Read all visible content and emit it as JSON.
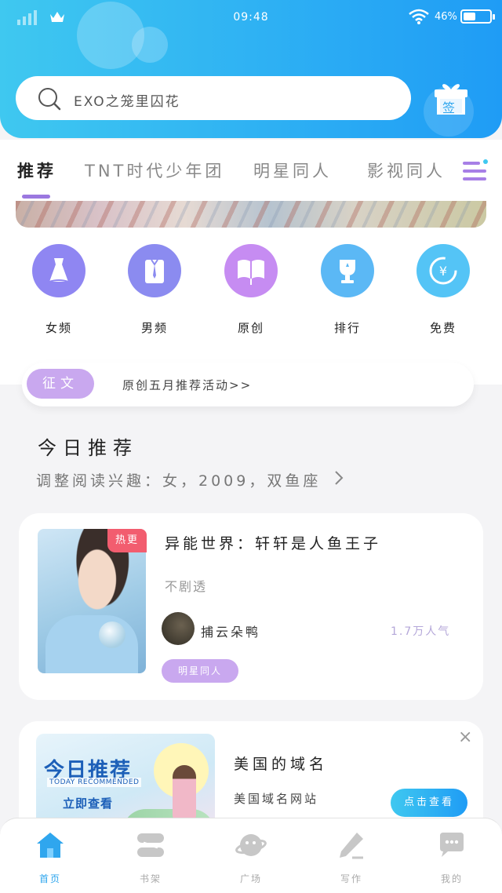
{
  "status_bar": {
    "time": "09:48",
    "battery_percent": "46%",
    "battery_level": 0.46
  },
  "search": {
    "placeholder": "EXO之笼里囚花"
  },
  "gift_badge": "签",
  "tabs": [
    {
      "label": "推荐",
      "active": true
    },
    {
      "label": "TNT时代少年团",
      "active": false
    },
    {
      "label": "明星同人",
      "active": false
    },
    {
      "label": "影视同人",
      "active": false
    }
  ],
  "categories": [
    {
      "label": "女频",
      "icon": "dress-icon",
      "color": "#8f86f2"
    },
    {
      "label": "男频",
      "icon": "shirt-icon",
      "color": "#8b8bf0"
    },
    {
      "label": "原创",
      "icon": "book-icon",
      "color": "#c68cf2"
    },
    {
      "label": "排行",
      "icon": "trophy-icon",
      "color": "#5bb8f5"
    },
    {
      "label": "免费",
      "icon": "yen-icon",
      "color": "#54c4f6"
    }
  ],
  "notice": {
    "badge": "征文",
    "text": "原创五月推荐活动>>"
  },
  "recommend": {
    "title": "今日推荐",
    "subtitle": "调整阅读兴趣：女，2009，双鱼座"
  },
  "book": {
    "badge": "热更",
    "title": "异能世界：轩轩是人鱼王子",
    "description": "不剧透",
    "author": "捕云朵鸭",
    "popularity": "1.7万人气",
    "tag": "明星同人"
  },
  "ad": {
    "image_title": "今日推荐",
    "image_subtitle": "TODAY RECOMMENDED",
    "image_cta": "立即查看",
    "title": "美国的域名",
    "subtitle": "美国域名网站",
    "button": "点击查看",
    "close": "×"
  },
  "bottom_nav": [
    {
      "label": "首页",
      "icon": "home-icon",
      "active": true
    },
    {
      "label": "书架",
      "icon": "bookshelf-icon",
      "active": false
    },
    {
      "label": "广场",
      "icon": "planet-icon",
      "active": false
    },
    {
      "label": "写作",
      "icon": "pen-icon",
      "active": false
    },
    {
      "label": "我的",
      "icon": "chat-bubble-icon",
      "active": false
    }
  ],
  "colors": {
    "primary_blue": "#2fb2f3",
    "accent_purple": "#c9a8ef",
    "hot_red": "#f25d6f"
  }
}
